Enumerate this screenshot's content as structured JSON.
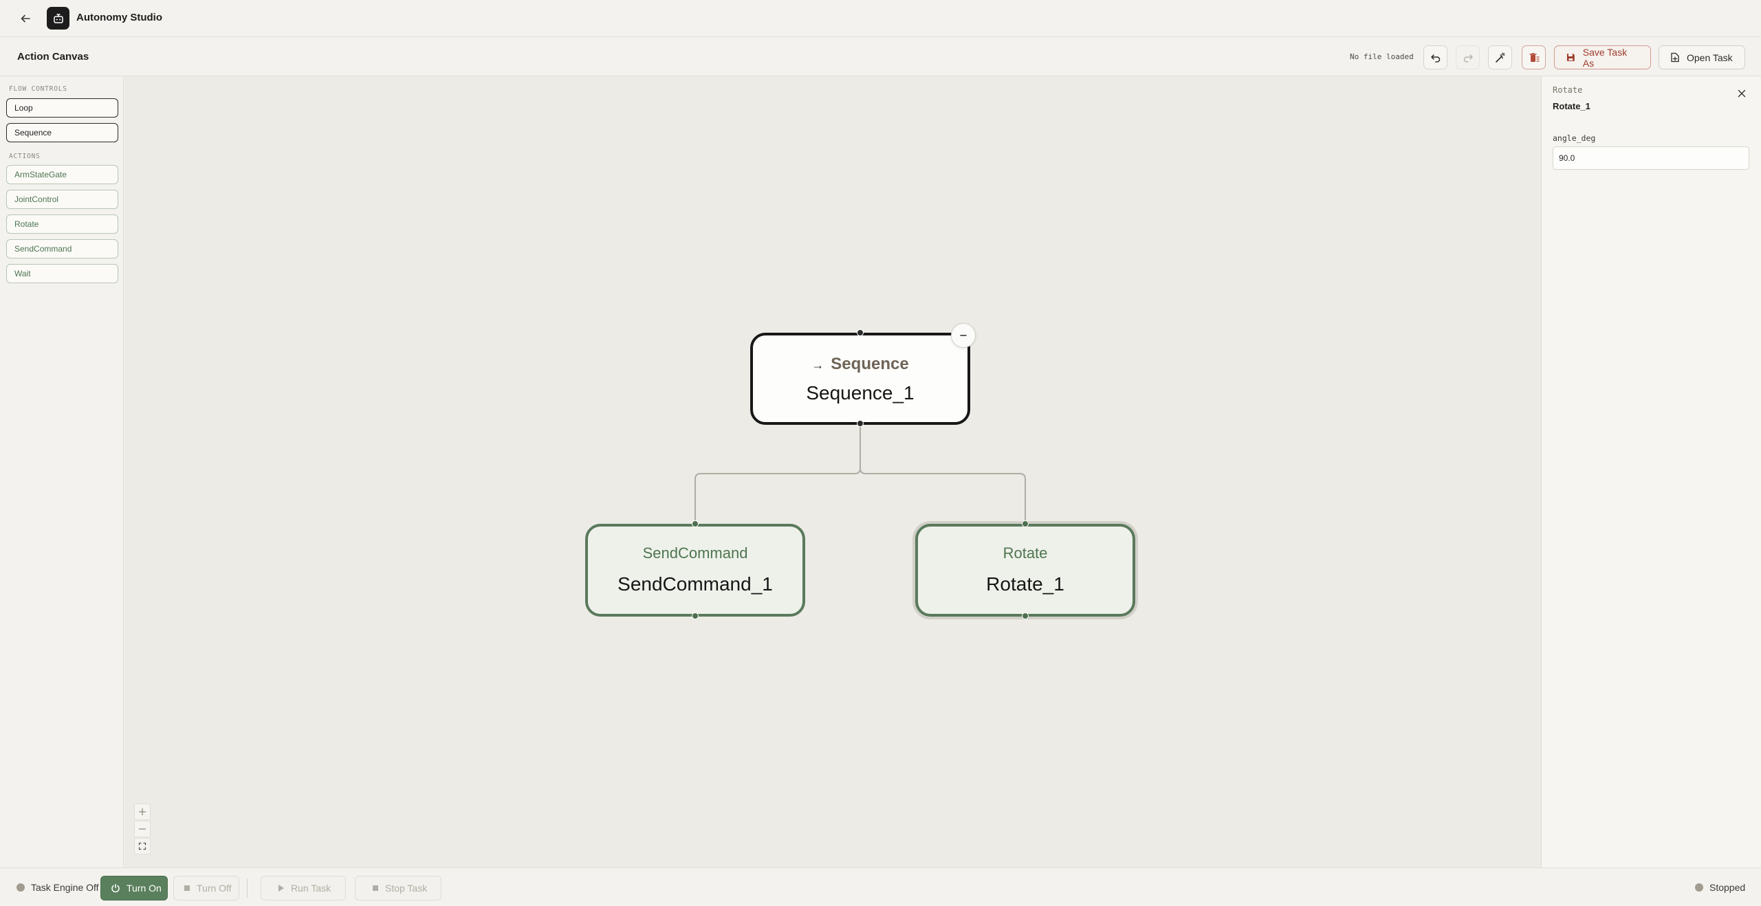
{
  "app": {
    "title": "Autonomy Studio"
  },
  "toolbar": {
    "page_title": "Action Canvas",
    "file_status": "No file loaded",
    "save_label": "Save Task As",
    "open_label": "Open Task"
  },
  "palette": {
    "flow_heading": "FLOW CONTROLS",
    "flow_items": [
      "Loop",
      "Sequence"
    ],
    "actions_heading": "ACTIONS",
    "action_items": [
      "ArmStateGate",
      "JointControl",
      "Rotate",
      "SendCommand",
      "Wait"
    ]
  },
  "canvas": {
    "nodes": {
      "sequence": {
        "type": "Sequence",
        "arrow": "→",
        "name": "Sequence_1"
      },
      "send": {
        "type": "SendCommand",
        "name": "SendCommand_1"
      },
      "rotate": {
        "type": "Rotate",
        "name": "Rotate_1",
        "selected": true
      }
    },
    "zoom_controls": [
      "+",
      "—",
      "⛶"
    ]
  },
  "inspector": {
    "node_type": "Rotate",
    "node_name": "Rotate_1",
    "param_label": "angle_deg",
    "param_value": "90.0"
  },
  "statusbar": {
    "engine_status": "Task Engine Off",
    "turn_on_label": "Turn On",
    "turn_off_label": "Turn Off",
    "run_label": "Run Task",
    "stop_label": "Stop Task",
    "run_state": "Stopped"
  },
  "colors": {
    "accent_green": "#5a7f5c",
    "danger": "#9e3b2c",
    "canvas_bg": "#ecebe5"
  }
}
